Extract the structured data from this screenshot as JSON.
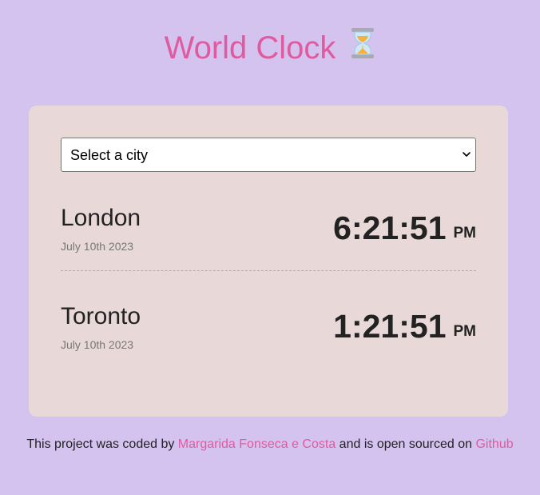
{
  "header": {
    "title": "World Clock",
    "emoji": "⏳",
    "accent_color": "#e05aa0"
  },
  "city_select": {
    "selected_label": "Select a city"
  },
  "cities": [
    {
      "name": "London",
      "date": "July 10th 2023",
      "time": "6:21:51",
      "ampm": "PM"
    },
    {
      "name": "Toronto",
      "date": "July 10th 2023",
      "time": "1:21:51",
      "ampm": "PM"
    }
  ],
  "footer": {
    "text_before": "This project was coded by ",
    "author_link": "Margarida Fonseca e Costa",
    "text_middle": " and is open sourced on ",
    "repo_link": "Github"
  },
  "colors": {
    "background": "#d4c3ee",
    "card": "#e8d9d8"
  }
}
